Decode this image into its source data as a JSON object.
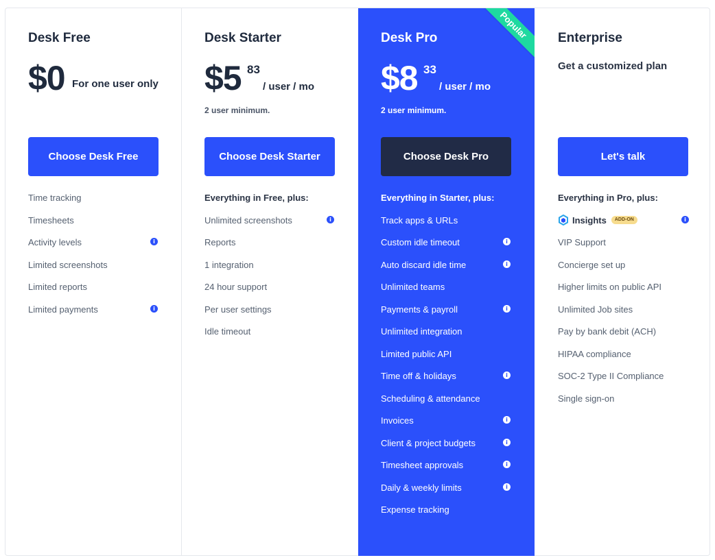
{
  "plans": {
    "free": {
      "name": "Desk Free",
      "price": "$0",
      "price_note": "For one user only",
      "cta": "Choose Desk Free",
      "features": [
        {
          "label": "Time tracking",
          "info": false
        },
        {
          "label": "Timesheets",
          "info": false
        },
        {
          "label": "Activity levels",
          "info": true
        },
        {
          "label": "Limited screenshots",
          "info": false
        },
        {
          "label": "Limited reports",
          "info": false
        },
        {
          "label": "Limited payments",
          "info": true
        }
      ]
    },
    "starter": {
      "name": "Desk Starter",
      "price": "$5",
      "cents": "83",
      "unit": "/ user / mo",
      "minimum": "2 user minimum.",
      "cta": "Choose Desk Starter",
      "lead": "Everything in Free, plus:",
      "features": [
        {
          "label": "Unlimited screenshots",
          "info": true
        },
        {
          "label": "Reports",
          "info": false
        },
        {
          "label": "1 integration",
          "info": false
        },
        {
          "label": "24 hour support",
          "info": false
        },
        {
          "label": "Per user settings",
          "info": false
        },
        {
          "label": "Idle timeout",
          "info": false
        }
      ]
    },
    "pro": {
      "name": "Desk Pro",
      "ribbon": "Popular",
      "price": "$8",
      "cents": "33",
      "unit": "/ user / mo",
      "minimum": "2 user minimum.",
      "cta": "Choose Desk Pro",
      "lead": "Everything in Starter, plus:",
      "features": [
        {
          "label": "Track apps & URLs",
          "info": false
        },
        {
          "label": "Custom idle timeout",
          "info": true
        },
        {
          "label": "Auto discard idle time",
          "info": true
        },
        {
          "label": "Unlimited teams",
          "info": false
        },
        {
          "label": "Payments & payroll",
          "info": true
        },
        {
          "label": "Unlimited integration",
          "info": false
        },
        {
          "label": "Limited public API",
          "info": false
        },
        {
          "label": "Time off & holidays",
          "info": true
        },
        {
          "label": "Scheduling & attendance",
          "info": false
        },
        {
          "label": "Invoices",
          "info": true
        },
        {
          "label": "Client & project budgets",
          "info": true
        },
        {
          "label": "Timesheet approvals",
          "info": true
        },
        {
          "label": "Daily & weekly limits",
          "info": true
        },
        {
          "label": "Expense tracking",
          "info": false
        }
      ]
    },
    "enterprise": {
      "name": "Enterprise",
      "tagline": "Get a customized plan",
      "cta": "Let's talk",
      "lead": "Everything in Pro, plus:",
      "insights_label": "Insights",
      "addon_badge": "ADD-ON",
      "features": [
        {
          "label": "VIP Support",
          "info": false
        },
        {
          "label": "Concierge set up",
          "info": false
        },
        {
          "label": "Higher limits on public API",
          "info": false
        },
        {
          "label": "Unlimited Job sites",
          "info": false
        },
        {
          "label": "Pay by bank debit (ACH)",
          "info": false
        },
        {
          "label": "HIPAA compliance",
          "info": false
        },
        {
          "label": "SOC-2 Type II Compliance",
          "info": false
        },
        {
          "label": "Single sign-on",
          "info": false
        }
      ]
    }
  },
  "icons": {
    "info": "info-icon",
    "insights": "insights-logo-icon"
  },
  "colors": {
    "accent": "#2b50fb",
    "dark_button": "#212b46",
    "ribbon": "#1ed9a0",
    "badge": "#f7dc8e"
  }
}
